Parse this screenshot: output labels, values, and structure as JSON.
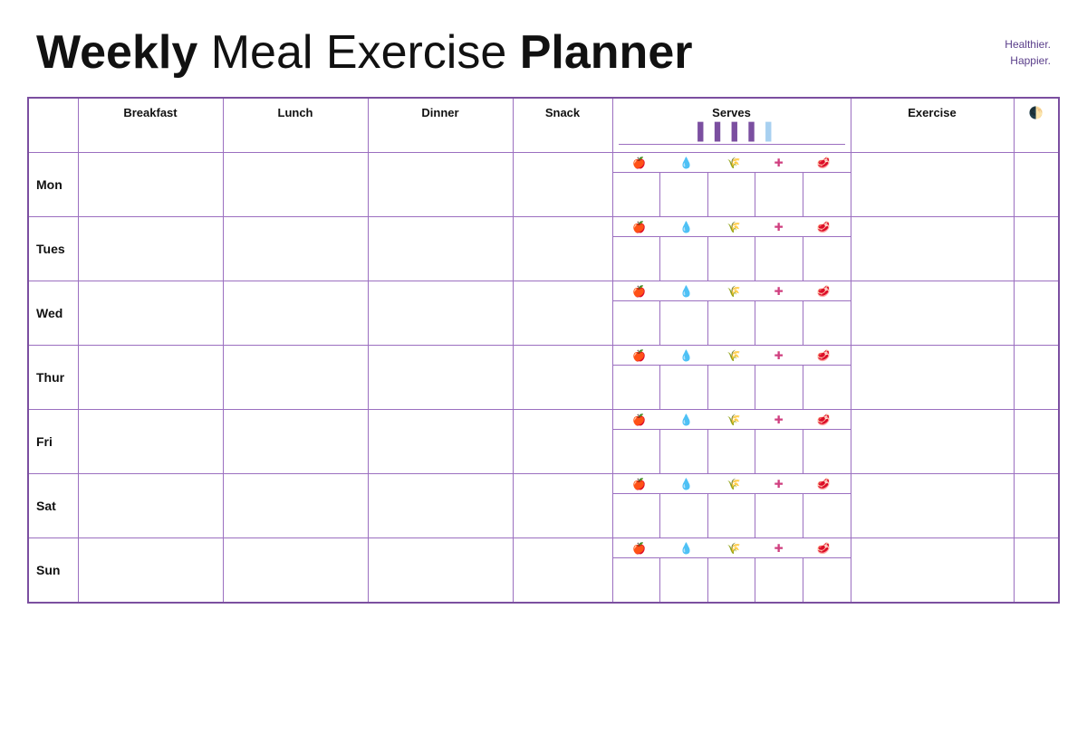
{
  "header": {
    "title_part1_bold": "Weekly",
    "title_part2_normal": " Meal ",
    "title_part3_normal": "   Exercise ",
    "title_part4_bold": "Planner",
    "brand_line1": "Healthier.",
    "brand_line2": "Happier."
  },
  "columns": {
    "day": "",
    "breakfast": "Breakfast",
    "lunch": "Lunch",
    "dinner": "Dinner",
    "snack": "Snack",
    "serves": "Serves",
    "exercise": "Exercise",
    "moon": "🌓"
  },
  "days": [
    {
      "label": "Mon"
    },
    {
      "label": "Tues"
    },
    {
      "label": "Wed"
    },
    {
      "label": "Thur"
    },
    {
      "label": "Fri"
    },
    {
      "label": "Sat"
    },
    {
      "label": "Sun"
    }
  ],
  "serves_icons": [
    "🍎",
    "💧",
    "🍞",
    "✚",
    "🥩"
  ],
  "serves_icons_header": [
    "▌",
    "▌",
    "▌",
    "▌",
    "░"
  ]
}
